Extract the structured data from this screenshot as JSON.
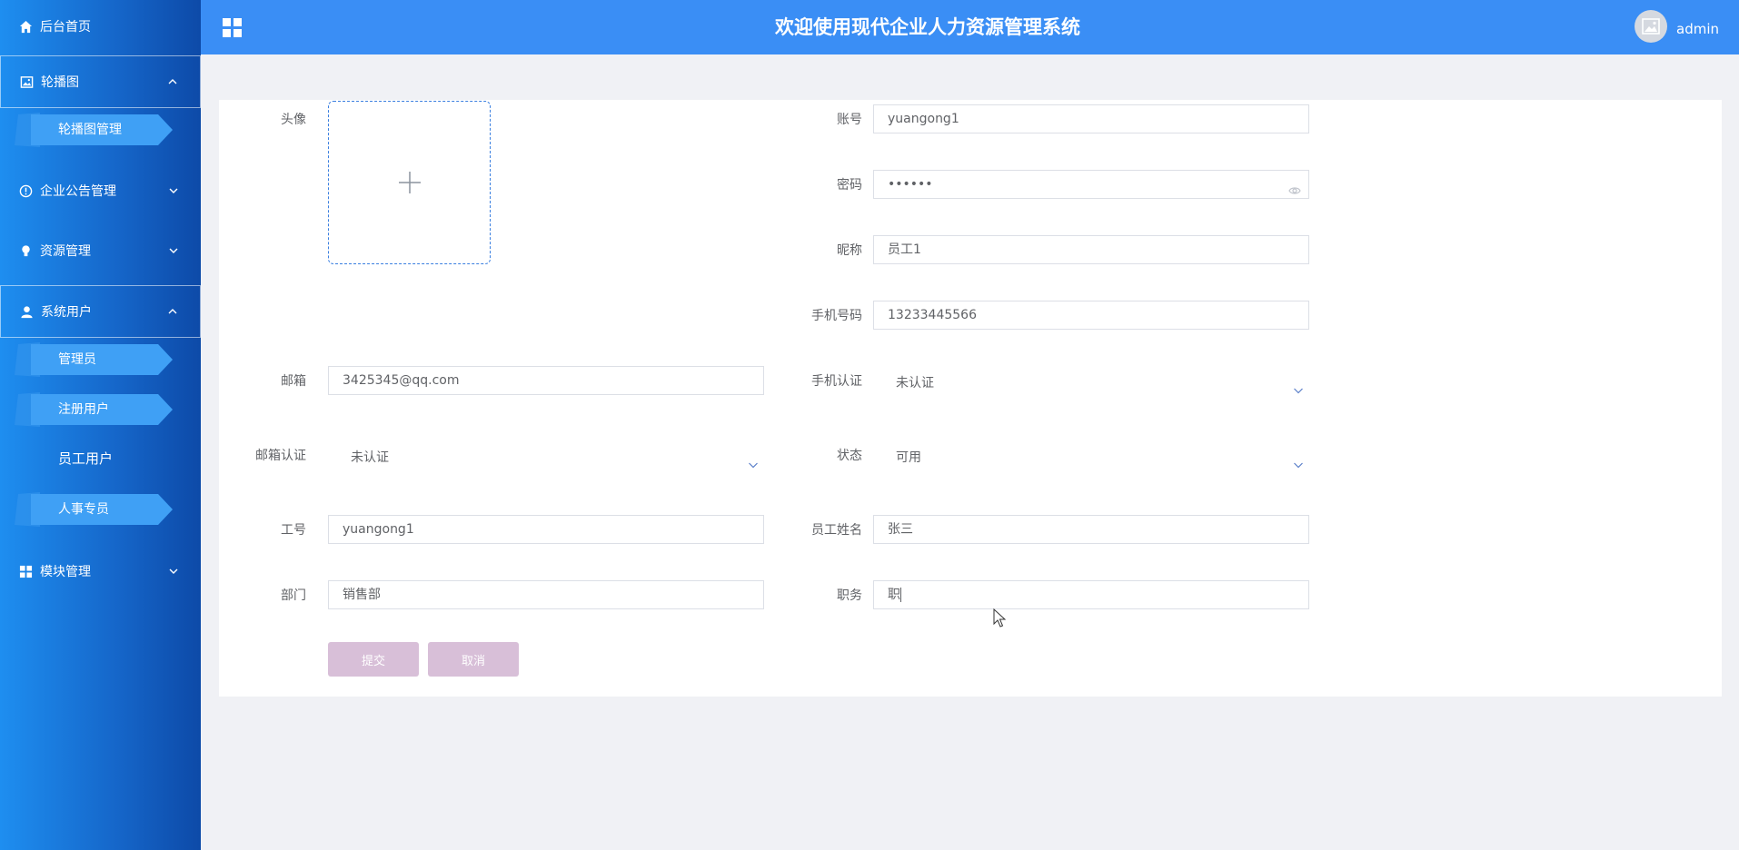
{
  "sidebar": {
    "home": "后台首页",
    "carousel": {
      "label": "轮播图",
      "items": [
        "轮播图管理"
      ]
    },
    "notice": {
      "label": "企业公告管理"
    },
    "resource": {
      "label": "资源管理"
    },
    "users": {
      "label": "系统用户",
      "items": [
        "管理员",
        "注册用户",
        "员工用户",
        "人事专员"
      ]
    },
    "module": {
      "label": "模块管理"
    }
  },
  "header": {
    "title": "欢迎使用现代企业人力资源管理系统",
    "username": "admin"
  },
  "form": {
    "avatar_label": "头像",
    "account_label": "账号",
    "account_value": "yuangong1",
    "password_label": "密码",
    "password_value": "••••••",
    "nickname_label": "昵称",
    "nickname_value": "员工1",
    "phone_label": "手机号码",
    "phone_value": "13233445566",
    "email_label": "邮箱",
    "email_value": "3425345@qq.com",
    "phone_verify_label": "手机认证",
    "phone_verify_value": "未认证",
    "email_verify_label": "邮箱认证",
    "email_verify_value": "未认证",
    "status_label": "状态",
    "status_value": "可用",
    "empno_label": "工号",
    "empno_value": "yuangong1",
    "empname_label": "员工姓名",
    "empname_value": "张三",
    "dept_label": "部门",
    "dept_value": "销售部",
    "position_label": "职务",
    "position_value": "职",
    "submit_label": "提交",
    "cancel_label": "取消"
  },
  "colors": {
    "header_bg": "#3a8ef5",
    "sidebar_top": "#1e8ef0",
    "sidebar_bottom": "#0d4aa8",
    "button_bg": "#d8bfd8",
    "upload_border": "#3a7fe0"
  }
}
